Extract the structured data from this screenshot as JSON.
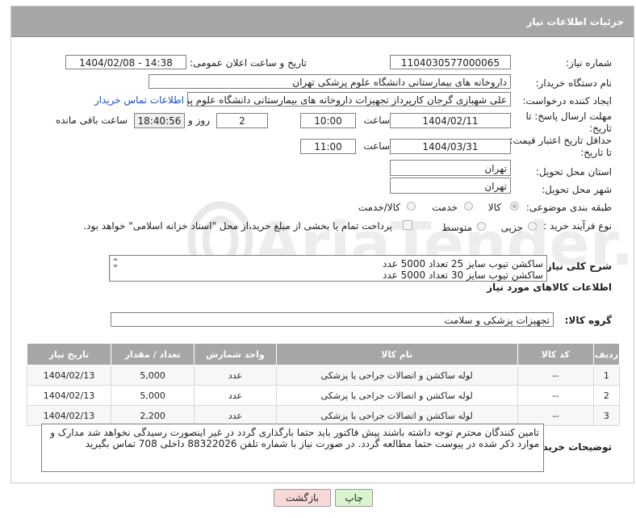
{
  "panel": {
    "title": "جزئیات اطلاعات نیاز"
  },
  "need_number": {
    "label": "شماره نیاز:",
    "value": "1104030577000065"
  },
  "announce": {
    "label": "تاریخ و ساعت اعلان عمومی:",
    "value": "1404/02/08 - 14:38"
  },
  "buyer_org": {
    "label": "نام دستگاه خریدار:",
    "value": "داروخانه های بیمارستانی دانشگاه علوم پزشکی تهران"
  },
  "requester": {
    "label": "ایجاد کننده درخواست:",
    "value": "علی شهبازی گرجان کارپرداز تجهیزات داروخانه های بیمارستانی دانشگاه علوم پزشکی تهران",
    "contact_link": "اطلاعات تماس خریدار"
  },
  "reply_deadline": {
    "label_line1": "مهلت ارسال پاسخ: تا",
    "label_line2": "تاریخ:",
    "date": "1404/02/11",
    "time_label": "ساعت",
    "time": "10:00",
    "days": "2",
    "days_label": "روز و",
    "remaining": "18:40:56",
    "remaining_label": "ساعت باقی مانده"
  },
  "price_validity": {
    "label_line1": "حداقل تاریخ اعتبار قیمت:",
    "label_line2": "تا تاریخ:",
    "date": "1404/03/31",
    "time_label": "ساعت",
    "time": "11:00"
  },
  "province": {
    "label": "استان محل تحویل:",
    "value": "تهران"
  },
  "city": {
    "label": "شهر محل تحویل:",
    "value": "تهران"
  },
  "category": {
    "label": "طبقه بندی موضوعی:",
    "options": [
      "کالا",
      "خدمت",
      "کالا/خدمت"
    ],
    "selected": "کالا"
  },
  "process": {
    "label": "نوع فرآیند خرید :",
    "options": [
      "جزیی",
      "متوسط"
    ],
    "note": "پرداخت تمام یا بخشی از مبلغ خرید،از محل \"اسناد خزانه اسلامی\" خواهد بود."
  },
  "summary": {
    "label": "شرح کلی نیاز:",
    "line1": "ساکشن تیوب سایز 25 تعداد 5000 عدد",
    "line2": "ساکشن تیوب سایز 30 تعداد 5000 عدد"
  },
  "goods_info": {
    "title": "اطلاعات کالاهای مورد نیاز"
  },
  "goods_group": {
    "label": "گروه کالا:",
    "value": "تجهیزات پزشکی و سلامت"
  },
  "table": {
    "headers": [
      "ردیف",
      "کد کالا",
      "نام کالا",
      "واحد شمارش",
      "تعداد / مقدار",
      "تاریخ نیاز"
    ],
    "rows": [
      [
        "1",
        "--",
        "لوله ساکشن و اتصالات جراحی یا پزشکی",
        "عدد",
        "5,000",
        "1404/02/13"
      ],
      [
        "2",
        "--",
        "لوله ساکشن و اتصالات جراحی یا پزشکی",
        "عدد",
        "5,000",
        "1404/02/13"
      ],
      [
        "3",
        "--",
        "لوله ساکشن و اتصالات جراحی یا پزشکی",
        "عدد",
        "2,200",
        "1404/02/13"
      ]
    ]
  },
  "notes": {
    "label": "توضیحات خریدار:",
    "text": "تامین کنندگان محترم توجه داشته باشند پیش فاکتور باید حتما بارگذاری گردد در غیر اینصورت رسیدگی نخواهد شد مدارک و موارد ذکر شده در پیوست حتما مطالعه گردد. در صورت نیاز با شماره تلفن 88322026 داخلی 708 تماس بگیرید"
  },
  "buttons": {
    "print": "چاپ",
    "back": "بازگشت"
  },
  "watermark": {
    "text": "AriaTender.neT"
  },
  "colors": {
    "header": "#a6a6a6",
    "link": "#1a4fc4",
    "print_button": "#d9f5d0",
    "back_button": "#f9d8d8"
  }
}
